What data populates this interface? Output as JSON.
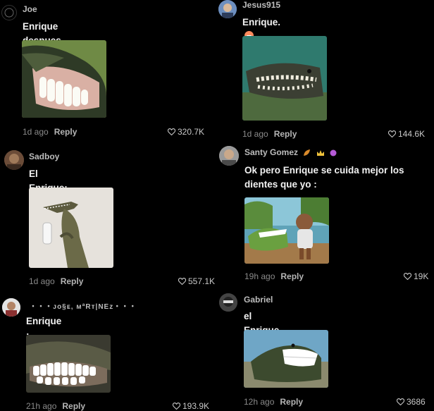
{
  "comments": [
    {
      "username": "Joe",
      "text": "Enrique despues",
      "time": "1d ago",
      "reply": "Reply",
      "likes": "320.7K",
      "image": "alligator-big-teeth-smile"
    },
    {
      "username": "Jesus915",
      "text": "Enrique.",
      "time": "1d ago",
      "reply": "Reply",
      "likes": "144.6K",
      "image": "underwater-crocodile-teeth"
    },
    {
      "username": "Sadboy",
      "text": "El Enrique:",
      "time": "1d ago",
      "reply": "Reply",
      "likes": "557.1K",
      "image": "crocodile-standing-in-bathroom"
    },
    {
      "username": "Santy Gomez",
      "text": "Ok pero Enrique se cuida mejor los dientes que yo :",
      "time": "19h ago",
      "reply": "Reply",
      "likes": "19K",
      "image": "boy-brushing-crocodile-teeth"
    },
    {
      "username": "・・・ᴊᴏ§ᴇ, ᴍªRᴛ|NEᴢ・・・",
      "text": "Enrique :",
      "time": "21h ago",
      "reply": "Reply",
      "likes": "193.9K",
      "image": "crocodile-white-teeth-grin"
    },
    {
      "username": "Gabriel",
      "text": "el Enrique",
      "time": "12h ago",
      "reply": "Reply",
      "likes": "3686",
      "image": "alligator-smile-on-shore"
    }
  ],
  "icons": {
    "like": "heart-outline-icon",
    "emoji": "grimacing-face-emoji",
    "badges": [
      "leaf-icon",
      "crown-icon",
      "purple-gem-icon"
    ]
  },
  "colors": {
    "background": "#000000",
    "username": "#bdbdbd",
    "meta": "#8a8a8a",
    "text": "#f2f2f2"
  }
}
